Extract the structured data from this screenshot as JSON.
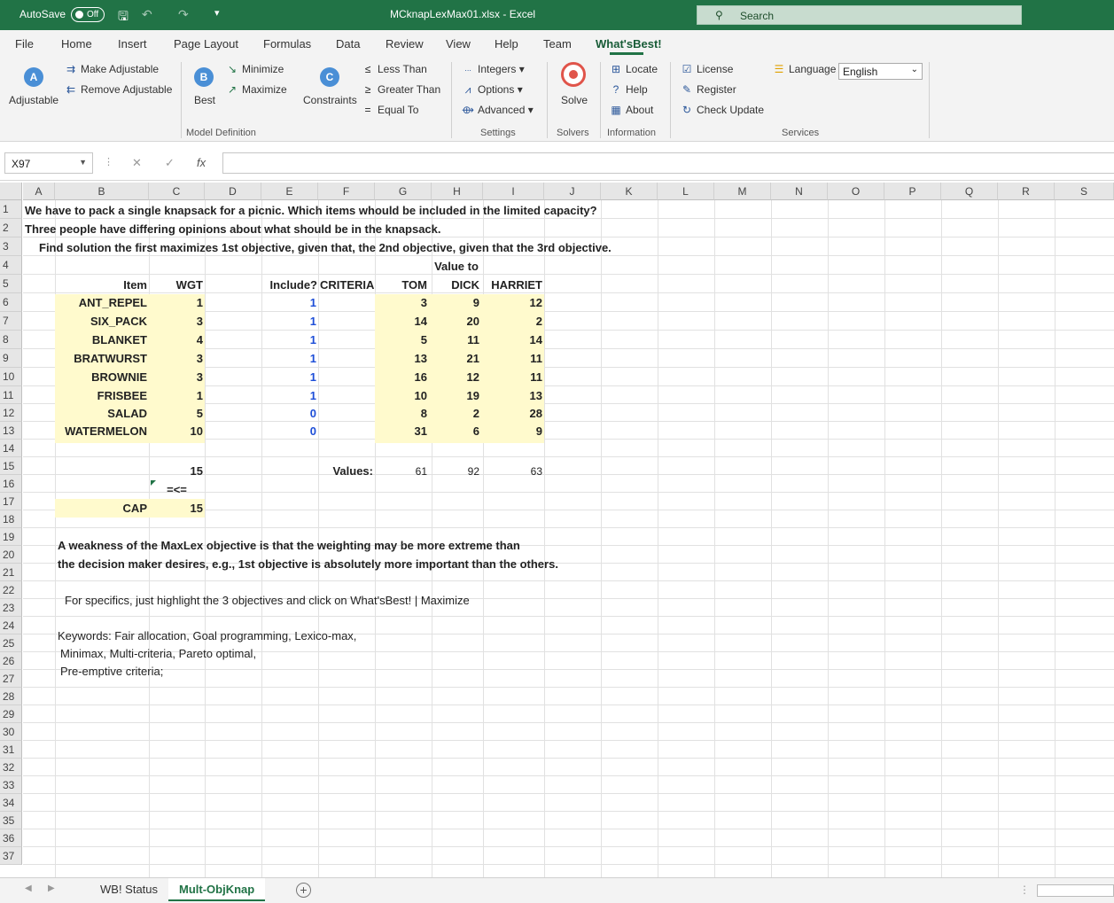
{
  "titlebar": {
    "autosave_label": "AutoSave",
    "autosave_state": "Off",
    "filename": "MCknapLexMax01.xlsx  -  Excel",
    "search_placeholder": "Search"
  },
  "menu": {
    "tabs": [
      "File",
      "Home",
      "Insert",
      "Page Layout",
      "Formulas",
      "Data",
      "Review",
      "View",
      "Help",
      "Team",
      "What'sBest!"
    ],
    "active_tab": "What'sBest!"
  },
  "ribbon": {
    "adjustable": "Adjustable",
    "make_adjustable": "Make Adjustable",
    "remove_adjustable": "Remove Adjustable",
    "best": "Best",
    "minimize": "Minimize",
    "maximize": "Maximize",
    "constraints": "Constraints",
    "less_than": "Less Than",
    "greater_than": "Greater Than",
    "equal_to": "Equal To",
    "model_definition": "Model Definition",
    "integers": "Integers",
    "options": "Options",
    "advanced": "Advanced",
    "settings": "Settings",
    "solve": "Solve",
    "solvers": "Solvers",
    "locate": "Locate",
    "help": "Help",
    "about": "About",
    "information": "Information",
    "license": "License",
    "register": "Register",
    "check_update": "Check Update",
    "language": "Language",
    "language_value": "English",
    "services": "Services"
  },
  "formula_bar": {
    "name_box": "X97",
    "formula": ""
  },
  "columns": [
    "A",
    "B",
    "C",
    "D",
    "E",
    "F",
    "G",
    "H",
    "I",
    "J",
    "K",
    "L",
    "M",
    "N",
    "O",
    "P",
    "Q",
    "R",
    "S"
  ],
  "rows": [
    "1",
    "2",
    "3",
    "4",
    "5",
    "6",
    "7",
    "8",
    "9",
    "10",
    "11",
    "12",
    "13",
    "14",
    "15",
    "16",
    "17",
    "18",
    "19",
    "20",
    "21",
    "22",
    "23",
    "24",
    "25",
    "26",
    "27",
    "28",
    "29",
    "30",
    "31",
    "32",
    "33",
    "34",
    "35",
    "36",
    "37"
  ],
  "sheet": {
    "r1": "We have to pack a single knapsack for a picnic.  Which items whould be included in the limited capacity?",
    "r2": "Three people have differing opinions about what should be in the knapsack.",
    "r3": "Find solution the first maximizes 1st objective, given that, the 2nd objective, given that the 3rd objective.",
    "value_to": "Value to",
    "hdr_item": "Item",
    "hdr_wgt": "WGT",
    "hdr_include": "Include?",
    "hdr_criteria": "CRITERIA",
    "hdr_tom": "TOM",
    "hdr_dick": "DICK",
    "hdr_harriet": "HARRIET",
    "items": [
      {
        "item": "ANT_REPEL",
        "wgt": "1",
        "include": "1",
        "tom": "3",
        "dick": "9",
        "harriet": "12"
      },
      {
        "item": "SIX_PACK",
        "wgt": "3",
        "include": "1",
        "tom": "14",
        "dick": "20",
        "harriet": "2"
      },
      {
        "item": "BLANKET",
        "wgt": "4",
        "include": "1",
        "tom": "5",
        "dick": "11",
        "harriet": "14"
      },
      {
        "item": "BRATWURST",
        "wgt": "3",
        "include": "1",
        "tom": "13",
        "dick": "21",
        "harriet": "11"
      },
      {
        "item": "BROWNIE",
        "wgt": "3",
        "include": "1",
        "tom": "16",
        "dick": "12",
        "harriet": "11"
      },
      {
        "item": "FRISBEE",
        "wgt": "1",
        "include": "1",
        "tom": "10",
        "dick": "19",
        "harriet": "13"
      },
      {
        "item": "SALAD",
        "wgt": "5",
        "include": "0",
        "tom": "8",
        "dick": "2",
        "harriet": "28"
      },
      {
        "item": "WATERMELON",
        "wgt": "10",
        "include": "0",
        "tom": "31",
        "dick": "6",
        "harriet": "9"
      }
    ],
    "total_wgt": "15",
    "le": "=<=",
    "values_label": "Values:",
    "val_tom": "61",
    "val_dick": "92",
    "val_harriet": "63",
    "cap_label": "CAP",
    "cap_value": "15",
    "r19": "A weakness of the MaxLex objective is that the weighting may be more extreme than",
    "r20": "the decision maker desires, e.g., 1st objective is absolutely more important than the others.",
    "r22": "For specifics,  just highlight the 3 objectives and click on What'sBest! | Maximize",
    "r24": "Keywords: Fair allocation, Goal programming, Lexico-max,",
    "r25": "Minimax, Multi-criteria, Pareto optimal,",
    "r26": "Pre-emptive criteria;"
  },
  "sheet_tabs": [
    "WB! Status",
    "Mult-ObjKnap"
  ],
  "active_sheet": "Mult-ObjKnap"
}
